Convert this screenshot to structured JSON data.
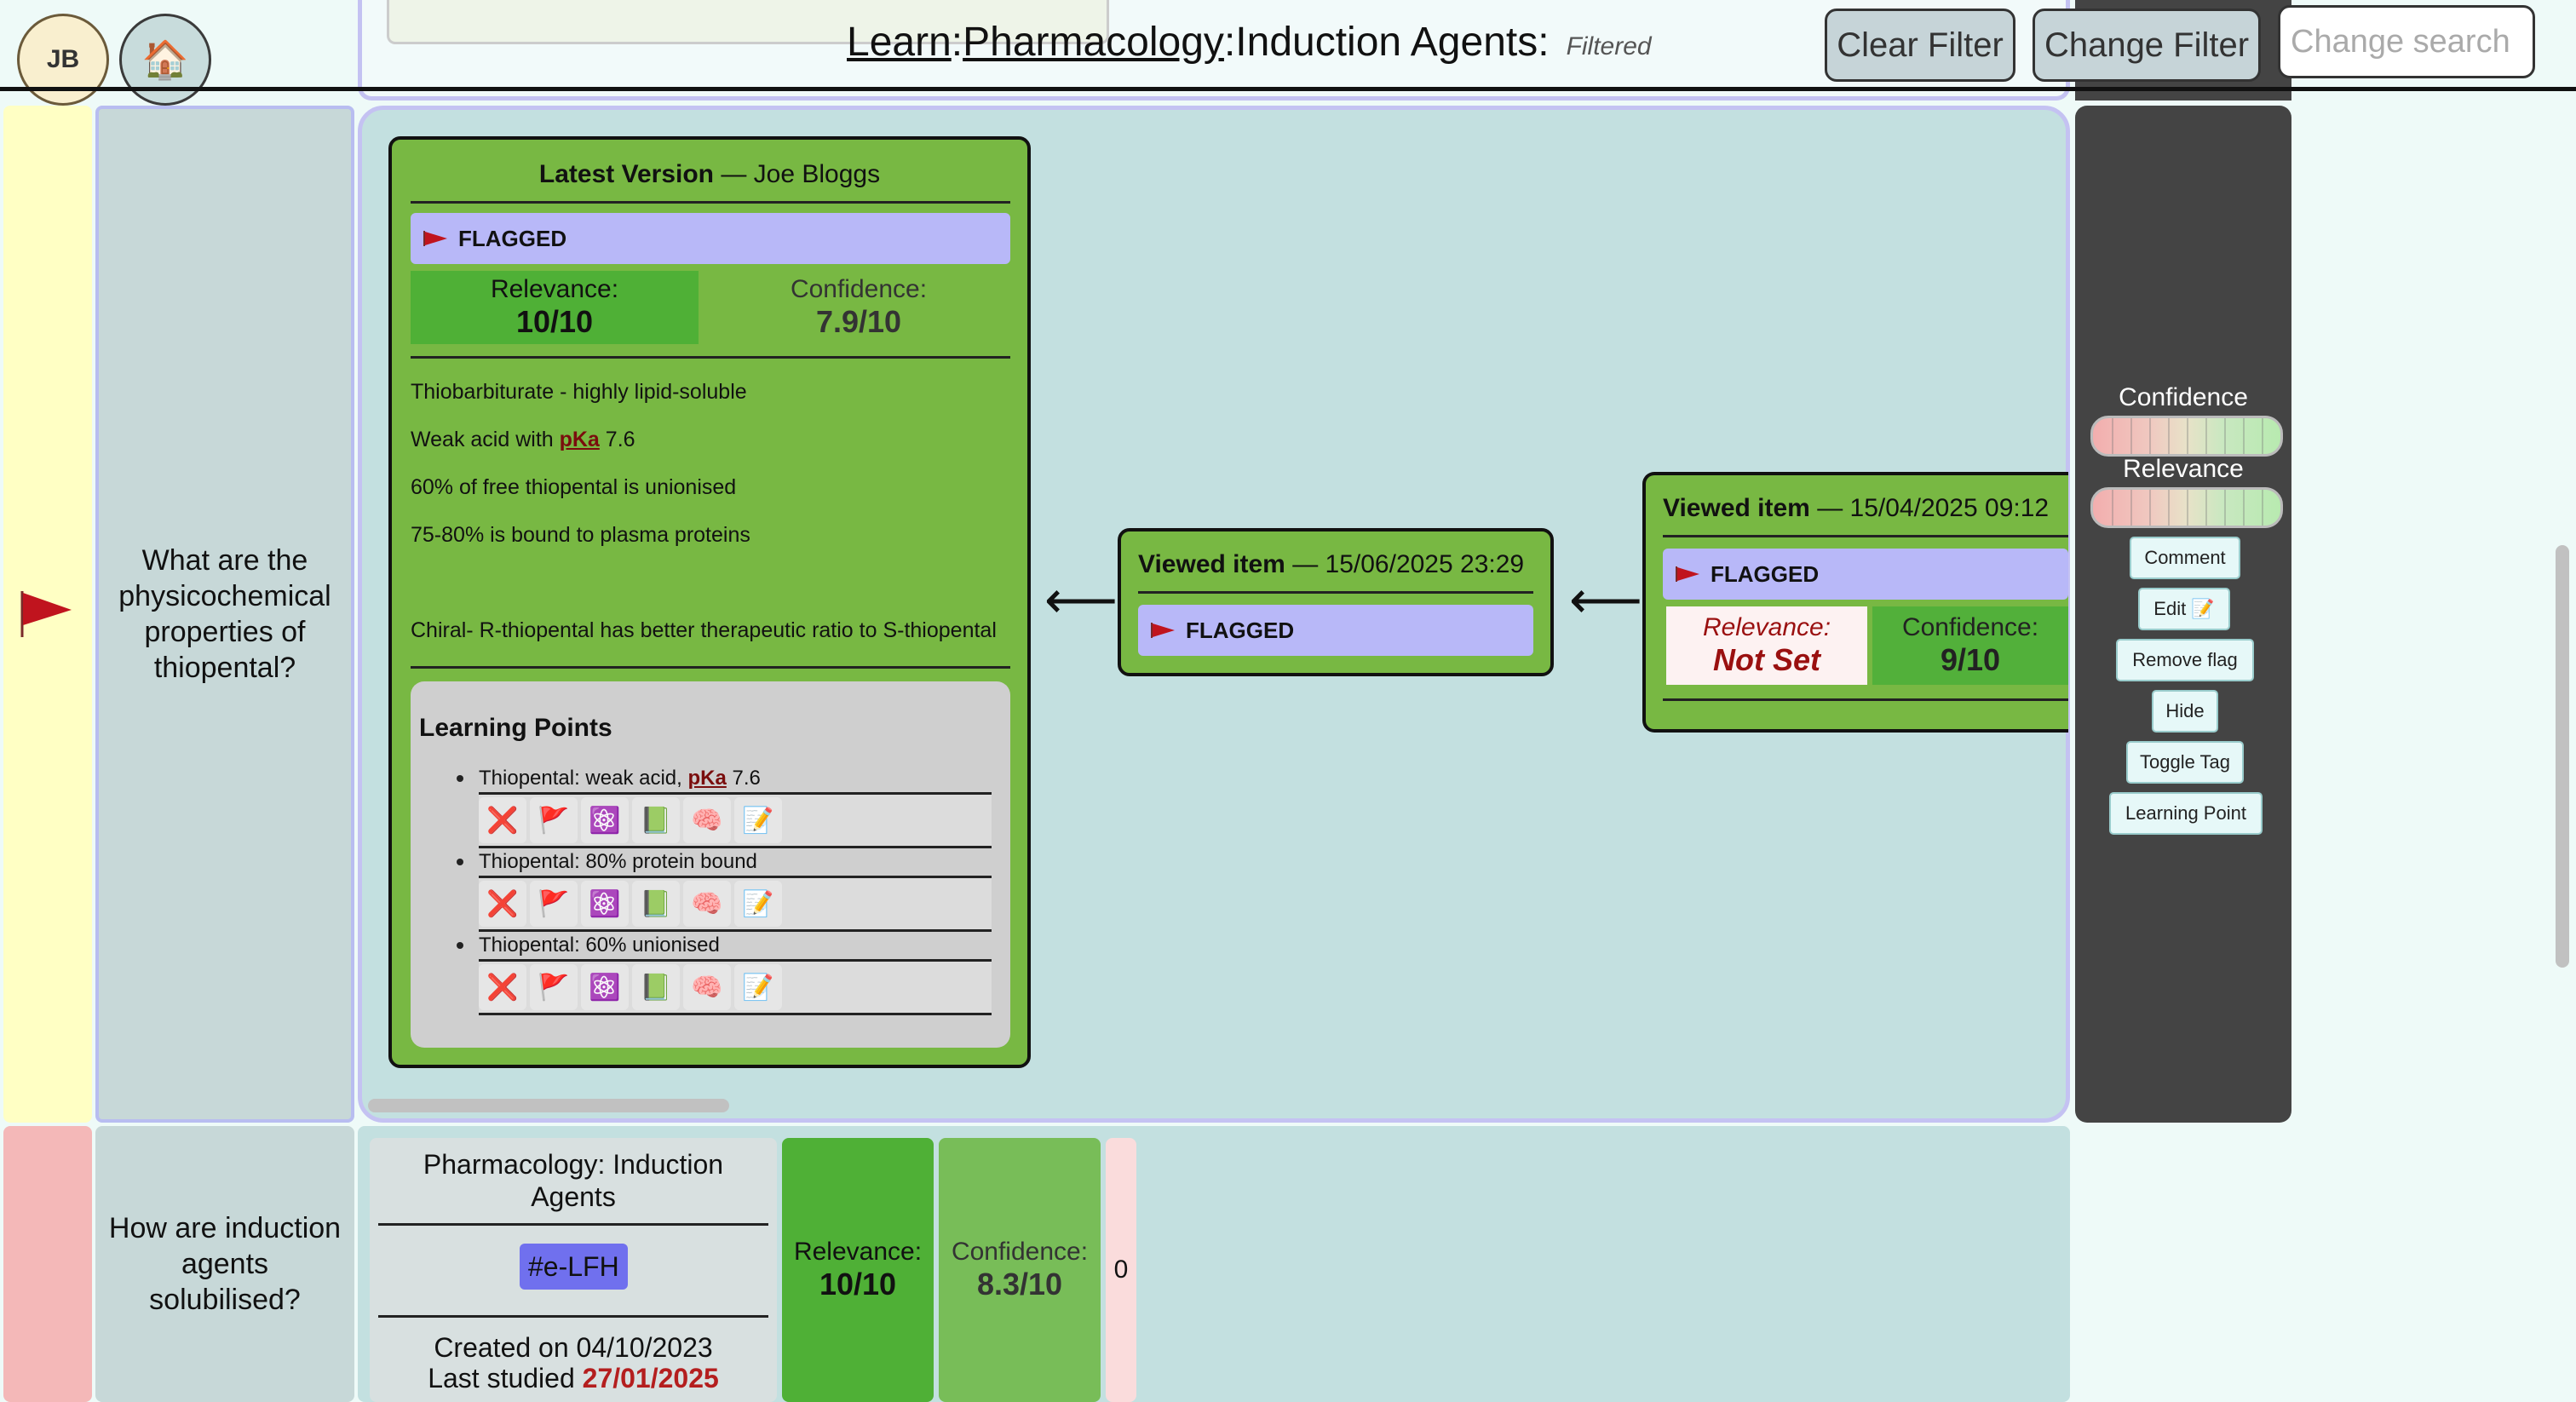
{
  "header": {
    "avatar_initials": "JB",
    "home_icon": "house-icon",
    "breadcrumb": {
      "learn": "Learn",
      "sep1": ": ",
      "pharmacology": "Pharmacology",
      "sep2": ": ",
      "topic": "Induction Agents:",
      "filtered": "Filtered"
    },
    "clear_filter": "Clear Filter",
    "change_filter": "Change Filter",
    "search_placeholder": "Change search"
  },
  "row1": {
    "question": "What are the physicochemical properties of thiopental?",
    "status_icon": "red-flag-icon",
    "latest": {
      "title_bold": "Latest Version",
      "title_rest": " — Joe Bloggs",
      "flag_label": "FLAGGED",
      "relevance_label": "Relevance:",
      "relevance_value": "10/10",
      "confidence_label": "Confidence:",
      "confidence_value": "7.9/10",
      "notes": {
        "n1": "Thiobarbiturate - highly lipid-soluble",
        "n2_pre": "Weak acid with ",
        "n2_link": "pKa",
        "n2_post": " 7.6",
        "n3": "60% of free thiopental is unionised",
        "n4": "75-80% is bound to plasma proteins",
        "n5": "Chiral- R-thiopental has better therapeutic ratio to S-thiopental"
      },
      "learning_points_title": "Learning Points",
      "learning_points": [
        {
          "pre": "Thiopental: weak acid, ",
          "link": "pKa",
          "post": " 7.6"
        },
        {
          "pre": "Thiopental: 80% protein bound",
          "link": "",
          "post": ""
        },
        {
          "pre": "Thiopental: 60% unionised",
          "link": "",
          "post": ""
        }
      ],
      "lp_icons": [
        "❌",
        "🚩",
        "⚛️",
        "📗",
        "🧠",
        "📝"
      ]
    },
    "viewed_1": {
      "title_bold": "Viewed item",
      "title_rest": " — 15/06/2025 23:29",
      "flag_label": "FLAGGED"
    },
    "viewed_2": {
      "title_bold": "Viewed item",
      "title_rest": " — 15/04/2025 09:12",
      "flag_label": "FLAGGED",
      "relevance_label": "Relevance:",
      "relevance_value": "Not Set",
      "confidence_label": "Confidence:",
      "confidence_value": "9/10"
    },
    "arrow": "⟵"
  },
  "side_panel": {
    "confidence_label": "Confidence",
    "relevance_label": "Relevance",
    "buttons": {
      "comment": "Comment",
      "edit": "Edit 📝",
      "remove_flag": "Remove flag",
      "hide": "Hide",
      "toggle_tag": "Toggle Tag",
      "learning_point": "Learning Point"
    }
  },
  "row2": {
    "question": "How are induction agents solubilised?",
    "topic": "Pharmacology: Induction Agents",
    "tag": "#e-LFH",
    "created": "Created on 04/10/2023",
    "last_studied_label": "Last studied ",
    "last_studied_date": "27/01/2025",
    "relevance_label": "Relevance:",
    "relevance_value": "10/10",
    "confidence_label": "Confidence:",
    "confidence_value": "8.3/10",
    "count": "0"
  },
  "colors": {
    "flag_red": "#c0141e",
    "card_green": "#78b843",
    "flag_bar": "#b8b8f8",
    "side_panel": "#444444",
    "last_studied": "#b41e1e"
  }
}
